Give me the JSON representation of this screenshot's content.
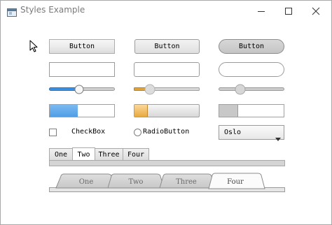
{
  "window": {
    "title": "Styles Example",
    "icon": "app-window-icon",
    "controls": [
      "minimize-icon",
      "maximize-icon",
      "close-icon"
    ]
  },
  "buttons": [
    "Button",
    "Button",
    "Button"
  ],
  "sliders": [
    {
      "value": 0.45,
      "accent": "#3c8fe0"
    },
    {
      "value": 0.24,
      "accent": "#e0a43c"
    },
    {
      "value": 0.32,
      "accent": "#9c9c9c"
    }
  ],
  "progress": [
    {
      "value": 0.44,
      "accent": "#5aa7ec"
    },
    {
      "value": 0.2,
      "accent": "#f0b85a"
    },
    {
      "value": 0.28,
      "accent": "#c8c8c8"
    }
  ],
  "checkbox": {
    "label": "CheckBox",
    "checked": false
  },
  "radio": {
    "label": "RadioButton",
    "checked": false
  },
  "combo": {
    "value": "Oslo"
  },
  "tabs_simple": {
    "items": [
      "One",
      "Two",
      "Three",
      "Four"
    ],
    "selected": 1
  },
  "tabs_rounded": {
    "items": [
      "One",
      "Two",
      "Three",
      "Four"
    ],
    "selected": 3
  }
}
